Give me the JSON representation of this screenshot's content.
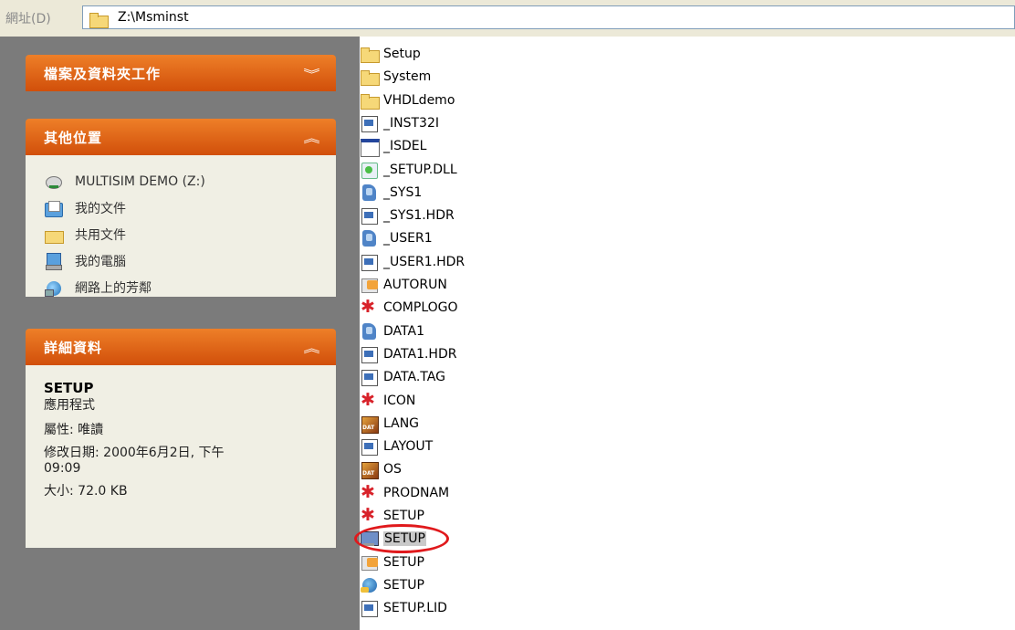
{
  "address_bar": {
    "label": "網址(D)",
    "path": "Z:\\Msminst"
  },
  "left_panel": {
    "file_tasks": {
      "title": "檔案及資料夾工作",
      "chevron": "︾"
    },
    "other_places": {
      "title": "其他位置",
      "chevron": "︽",
      "items": [
        {
          "label": "MULTISIM DEMO (Z:)",
          "icon": "drive-icon"
        },
        {
          "label": "我的文件",
          "icon": "my-documents-icon"
        },
        {
          "label": "共用文件",
          "icon": "shared-documents-icon"
        },
        {
          "label": "我的電腦",
          "icon": "my-computer-icon"
        },
        {
          "label": "網路上的芳鄰",
          "icon": "network-places-icon"
        }
      ]
    },
    "details": {
      "title": "詳細資料",
      "chevron": "︽",
      "name": "SETUP",
      "type": "應用程式",
      "attributes": "屬性: 唯讀",
      "modified_line1": "修改日期: 2000年6月2日, 下午",
      "modified_line2": "09:09",
      "size": "大小: 72.0 KB"
    }
  },
  "file_list": [
    {
      "name": "Setup",
      "icon": "folder-icon"
    },
    {
      "name": "System",
      "icon": "folder-icon"
    },
    {
      "name": "VHDLdemo",
      "icon": "folder-icon"
    },
    {
      "name": "_INST32I",
      "icon": "document-icon"
    },
    {
      "name": "_ISDEL",
      "icon": "window-app-icon"
    },
    {
      "name": "_SETUP.DLL",
      "icon": "dll-icon"
    },
    {
      "name": "_SYS1",
      "icon": "cabinet-icon"
    },
    {
      "name": "_SYS1.HDR",
      "icon": "document-icon"
    },
    {
      "name": "_USER1",
      "icon": "cabinet-icon"
    },
    {
      "name": "_USER1.HDR",
      "icon": "document-icon"
    },
    {
      "name": "AUTORUN",
      "icon": "setup-info-icon"
    },
    {
      "name": "COMPLOGO",
      "icon": "red-star-icon"
    },
    {
      "name": "DATA1",
      "icon": "cabinet-icon"
    },
    {
      "name": "DATA1.HDR",
      "icon": "document-icon"
    },
    {
      "name": "DATA.TAG",
      "icon": "document-icon"
    },
    {
      "name": "ICON",
      "icon": "red-star-icon"
    },
    {
      "name": "LANG",
      "icon": "dat-icon"
    },
    {
      "name": "LAYOUT",
      "icon": "document-icon"
    },
    {
      "name": "OS",
      "icon": "dat-icon"
    },
    {
      "name": "PRODNAM",
      "icon": "red-star-icon"
    },
    {
      "name": "SETUP",
      "icon": "red-star-icon"
    },
    {
      "name": "SETUP",
      "icon": "setup-exe-icon",
      "selected": true
    },
    {
      "name": "SETUP",
      "icon": "setup-info-icon"
    },
    {
      "name": "SETUP",
      "icon": "globe-icon"
    },
    {
      "name": "SETUP.LID",
      "icon": "document-icon"
    }
  ],
  "colors": {
    "panel_bg": "#7b7b7b",
    "group_header": "#e0651a",
    "group_body": "#f0efe4",
    "highlight_ring": "#e0191c"
  }
}
